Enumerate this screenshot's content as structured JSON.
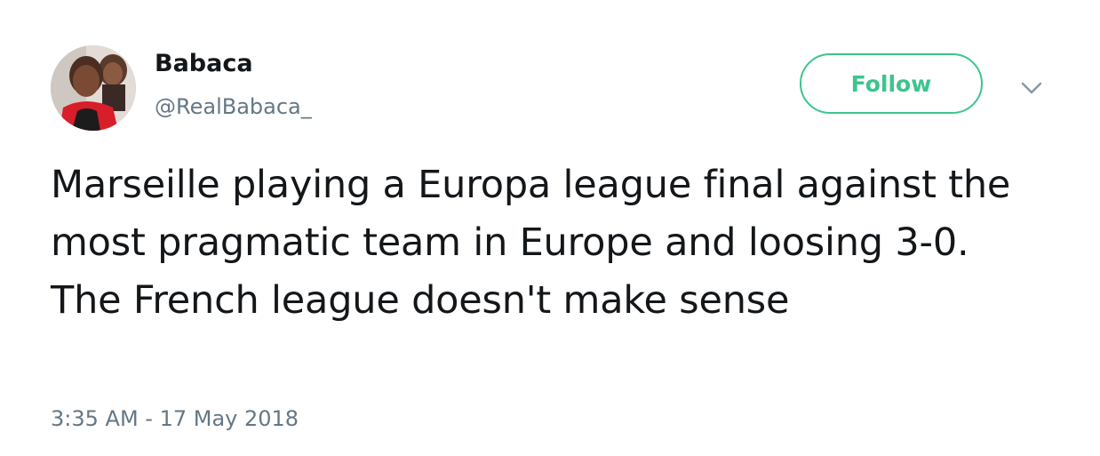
{
  "author": {
    "display_name": "Babaca",
    "handle": "@RealBabaca_",
    "avatar_icon": "profile-photo"
  },
  "actions": {
    "follow_label": "Follow",
    "more_icon": "chevron-down-icon"
  },
  "tweet": {
    "text": "Marseille playing a Europa league final against the most pragmatic team in Europe and loosing 3-0. The French league doesn't make sense",
    "timestamp": "3:35 AM - 17 May 2018"
  },
  "colors": {
    "follow_accent": "#3cc58d",
    "secondary_text": "#657786",
    "primary_text": "#14171a"
  }
}
